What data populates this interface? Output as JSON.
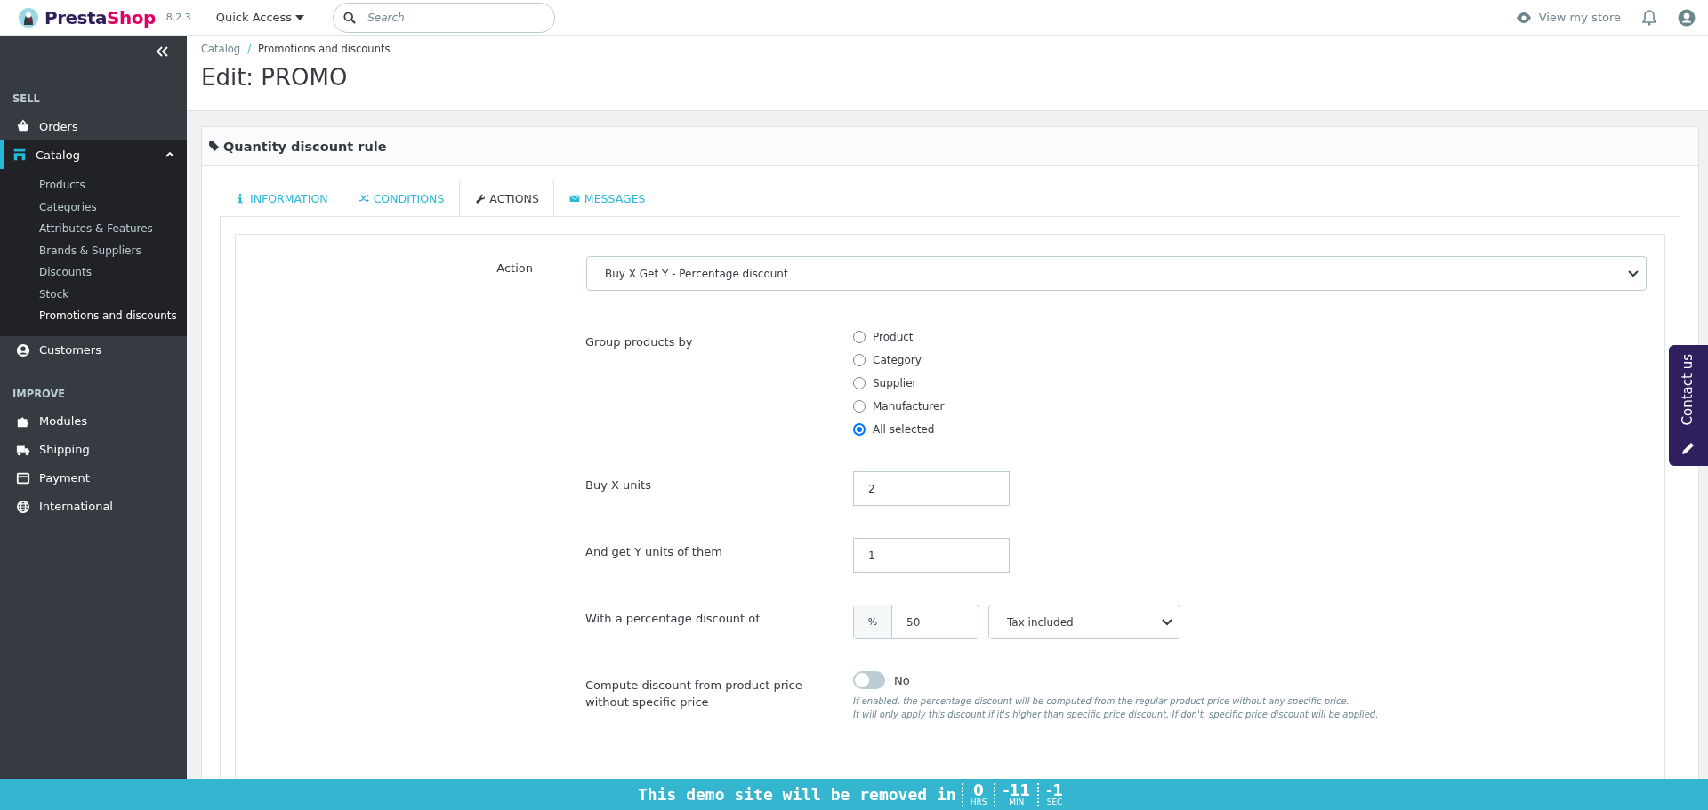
{
  "header": {
    "logo": [
      "Presta",
      "Shop"
    ],
    "version": "8.2.3",
    "quick_access": "Quick Access",
    "search": {
      "placeholder": "Search"
    },
    "view_store": "View my store"
  },
  "sidebar": {
    "sections": [
      {
        "title": "SELL",
        "items": [
          {
            "label": "Orders",
            "selected": false
          },
          {
            "label": "Catalog",
            "selected": true,
            "expanded": true,
            "children": [
              {
                "label": "Products",
                "selected": false
              },
              {
                "label": "Categories",
                "selected": false
              },
              {
                "label": "Attributes & Features",
                "selected": false
              },
              {
                "label": "Brands & Suppliers",
                "selected": false
              },
              {
                "label": "Discounts",
                "selected": false
              },
              {
                "label": "Stock",
                "selected": false
              },
              {
                "label": "Promotions and discounts",
                "selected": true
              }
            ]
          },
          {
            "label": "Customers",
            "selected": false
          }
        ]
      },
      {
        "title": "IMPROVE",
        "items": [
          {
            "label": "Modules",
            "selected": false
          },
          {
            "label": "Shipping",
            "selected": false
          },
          {
            "label": "Payment",
            "selected": false
          },
          {
            "label": "International",
            "selected": false
          }
        ]
      }
    ]
  },
  "breadcrumb": {
    "items": [
      "Catalog",
      "Promotions and discounts"
    ],
    "separator": "/"
  },
  "page_title": "Edit: PROMO",
  "panel": {
    "title": "Quantity discount rule",
    "tabs": [
      {
        "label": "INFORMATION",
        "selected": false
      },
      {
        "label": "CONDITIONS",
        "selected": false
      },
      {
        "label": "ACTIONS",
        "selected": true
      },
      {
        "label": "MESSAGES",
        "selected": false
      }
    ],
    "fields": [
      {
        "kind": "select",
        "label": "Action",
        "value": "Buy X Get Y - Percentage discount"
      },
      {
        "kind": "radio",
        "label": "Group products by",
        "options": [
          {
            "label": "Product",
            "selected": false
          },
          {
            "label": "Category",
            "selected": false
          },
          {
            "label": "Supplier",
            "selected": false
          },
          {
            "label": "Manufacturer",
            "selected": false
          },
          {
            "label": "All selected",
            "selected": true
          }
        ]
      },
      {
        "kind": "number",
        "label": "Buy X units",
        "value": "2"
      },
      {
        "kind": "number",
        "label": "And get Y units of them",
        "value": "1"
      },
      {
        "kind": "percent",
        "label": "With a percentage discount of",
        "addon": "%",
        "value": "50",
        "tax": "Tax included"
      },
      {
        "kind": "toggle",
        "label": "Compute discount from product price without specific price",
        "on": false,
        "state_text": "No",
        "help": [
          "If enabled, the percentage discount will be computed from the regular product price without any specific price.",
          "It will only apply this discount if it's higher than specific price discount. If don't, specific price discount will be applied."
        ]
      }
    ]
  },
  "contact_tab": "Contact us",
  "banner": {
    "text": "This demo site will be removed in",
    "counters": [
      {
        "value": "0",
        "unit": "HRS"
      },
      {
        "value": "-11",
        "unit": "MIN"
      },
      {
        "value": "-1",
        "unit": "SEC"
      }
    ]
  }
}
